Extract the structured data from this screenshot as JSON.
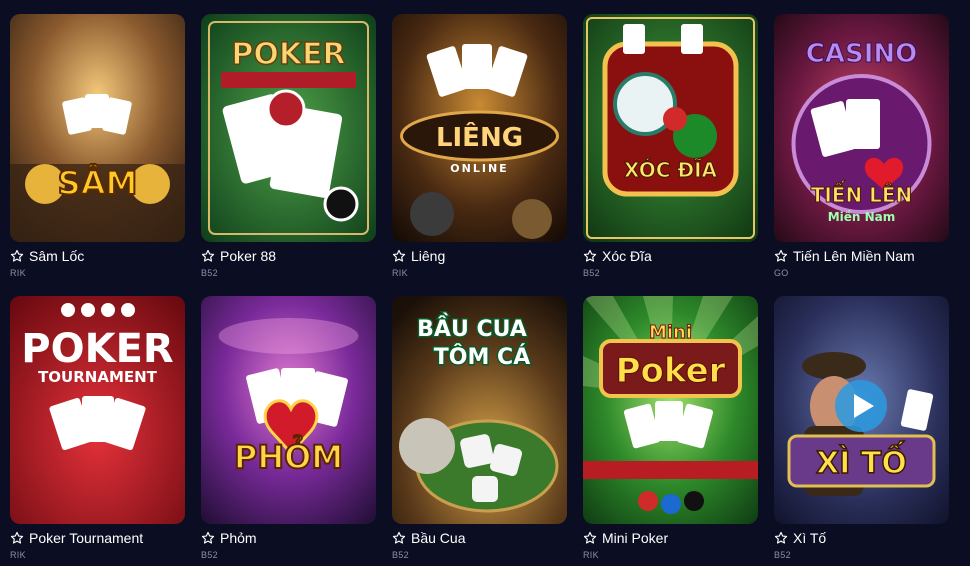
{
  "games": [
    {
      "title": "Sâm Lốc",
      "provider": "RIK",
      "art_text": "SÂM",
      "theme": "gold"
    },
    {
      "title": "Poker 88",
      "provider": "B52",
      "art_text": "POKER",
      "theme": "green"
    },
    {
      "title": "Liêng",
      "provider": "RIK",
      "art_text": "LIÊNG",
      "art_sub": "ONLINE",
      "theme": "amber"
    },
    {
      "title": "Xóc Đĩa",
      "provider": "B52",
      "art_text": "XÓC ĐĨA",
      "theme": "felt"
    },
    {
      "title": "Tiến Lên Miền Nam",
      "provider": "GO",
      "art_text": "TIẾN LÊN",
      "art_sub": "Miền Nam",
      "art_top": "CASINO",
      "theme": "purple"
    },
    {
      "title": "Poker Tournament",
      "provider": "RIK",
      "art_text": "POKER",
      "art_sub": "TOURNAMENT",
      "theme": "red"
    },
    {
      "title": "Phỏm",
      "provider": "B52",
      "art_text": "PHỎM",
      "theme": "violet"
    },
    {
      "title": "Bầu Cua",
      "provider": "B52",
      "art_text": "BẦU CUA",
      "art_sub": "TÔM CÁ",
      "theme": "tavern"
    },
    {
      "title": "Mini Poker",
      "provider": "RIK",
      "art_text": "Poker",
      "art_top": "Mini",
      "theme": "rays"
    },
    {
      "title": "Xì Tố",
      "provider": "B52",
      "art_text": "XÌ TỐ",
      "theme": "blue"
    }
  ],
  "icons": {
    "favorite": "star-outline-icon"
  },
  "colors": {
    "background": "#0b0d22",
    "title": "#ffffff",
    "provider": "#8d8fa3"
  }
}
